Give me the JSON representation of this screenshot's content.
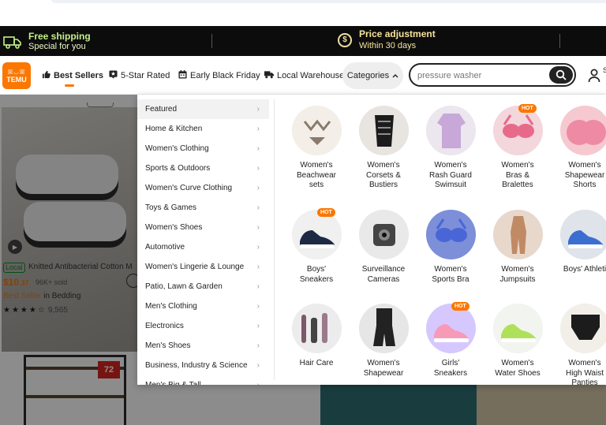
{
  "promo": {
    "free_shipping_title": "Free shipping",
    "free_shipping_sub": "Special for you",
    "price_adjustment_title": "Price adjustment",
    "price_adjustment_sub": "Within 30 days",
    "coin_symbol": "$"
  },
  "header": {
    "logo_mark": "ꕤ◡ꕤ",
    "logo_word": "TEMU",
    "nav": [
      {
        "label": "Best Sellers",
        "icon": "thumbs-up-icon"
      },
      {
        "label": "5-Star Rated",
        "icon": "star-badge-icon"
      },
      {
        "label": "Early Black Friday",
        "icon": "calendar-icon"
      },
      {
        "label": "Local Warehouse",
        "icon": "truck-icon"
      }
    ],
    "categories_label": "Categories",
    "search_value": "pressure washer",
    "user_letters": "S"
  },
  "background": {
    "local_badge": "Local",
    "product_title": "Knitted Antibacterial Cotton M",
    "price_main": "$10",
    "price_cents": ".37",
    "sold": "96K+ sold",
    "best_seller": "Best Seller",
    "best_seller_cat": " in Bedding",
    "stars": "★★★★☆",
    "rating_count": "9,565",
    "shelf_tag": "72"
  },
  "categories": [
    "Featured",
    "Home & Kitchen",
    "Women's Clothing",
    "Sports & Outdoors",
    "Women's Curve Clothing",
    "Toys & Games",
    "Women's Shoes",
    "Automotive",
    "Women's Lingerie & Lounge",
    "Patio, Lawn & Garden",
    "Men's Clothing",
    "Electronics",
    "Men's Shoes",
    "Business, Industry & Science",
    "Men's Big & Tall"
  ],
  "arrow_glyph": "›",
  "hot_label": "HOT",
  "tiles": [
    {
      "line1": "Women's",
      "line2": "Beachwear",
      "line3": "sets",
      "hot": false
    },
    {
      "line1": "Women's",
      "line2": "Corsets &",
      "line3": "Bustiers",
      "hot": false
    },
    {
      "line1": "Women's",
      "line2": "Rash Guard",
      "line3": "Swimsuit",
      "hot": false
    },
    {
      "line1": "Women's",
      "line2": "Bras &",
      "line3": "Bralettes",
      "hot": true
    },
    {
      "line1": "Women's",
      "line2": "Shapewear",
      "line3": "Shorts",
      "hot": false
    },
    {
      "line1": "Boys'",
      "line2": "Sneakers",
      "line3": "",
      "hot": true
    },
    {
      "line1": "Surveillance",
      "line2": "Cameras",
      "line3": "",
      "hot": false
    },
    {
      "line1": "Women's",
      "line2": "Sports Bra",
      "line3": "",
      "hot": false
    },
    {
      "line1": "Women's",
      "line2": "Jumpsuits",
      "line3": "",
      "hot": false
    },
    {
      "line1": "Boys' Athleti",
      "line2": "",
      "line3": "",
      "hot": false
    },
    {
      "line1": "Hair Care",
      "line2": "",
      "line3": "",
      "hot": false
    },
    {
      "line1": "Women's",
      "line2": "Shapewear",
      "line3": "",
      "hot": false
    },
    {
      "line1": "Girls'",
      "line2": "Sneakers",
      "line3": "",
      "hot": true
    },
    {
      "line1": "Women's",
      "line2": "Water Shoes",
      "line3": "",
      "hot": false
    },
    {
      "line1": "Women's",
      "line2": "High Waist",
      "line3": "Panties",
      "hot": false
    }
  ],
  "colors": {
    "brand_orange": "#fb7701",
    "promo_green": "#c5f08a",
    "promo_gold": "#f6e39c",
    "local_green": "#0a8a2d"
  }
}
